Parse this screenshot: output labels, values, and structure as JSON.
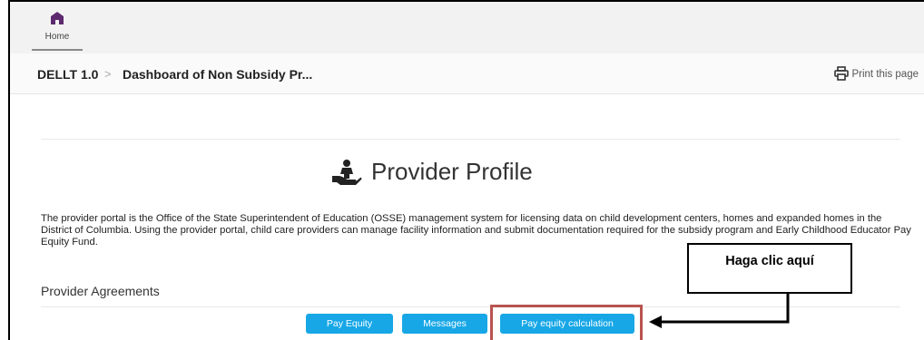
{
  "topbar": {
    "home_label": "Home"
  },
  "breadcrumb": {
    "app": "DELLT 1.0",
    "separator": ">",
    "page": "Dashboard of Non Subsidy Pr..."
  },
  "print_label": "Print this page",
  "profile": {
    "title": "Provider Profile",
    "description": "The provider portal is the Office of the State Superintendent of Education (OSSE) management system for licensing data on child development centers, homes and expanded homes in the District of Columbia. Using the provider portal, child care providers can manage facility information and submit documentation required for the subsidy program and Early Childhood Educator Pay Equity Fund."
  },
  "agreements": {
    "title": "Provider Agreements",
    "buttons": {
      "pay_equity": "Pay Equity",
      "messages": "Messages",
      "pay_equity_calc": "Pay equity calculation"
    }
  },
  "annotation": {
    "callout": "Haga clic aquí",
    "highlight_color": "#b85450"
  },
  "colors": {
    "button": "#17a7e6",
    "home_icon": "#5c2a6e"
  },
  "icons": {
    "home": "home-icon",
    "print": "printer-icon",
    "profile": "hand-holding-child-icon"
  }
}
